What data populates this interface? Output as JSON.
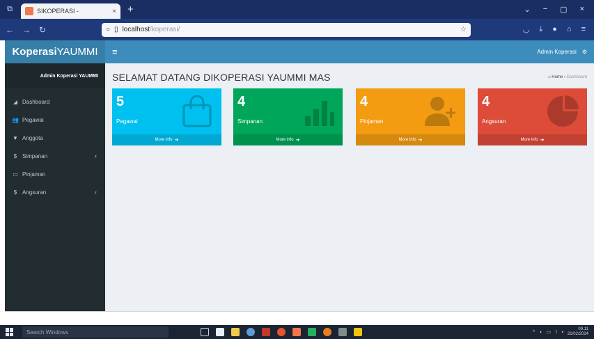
{
  "browser": {
    "tab_title": "SIKOPERASI - ",
    "tab_close": "×",
    "new_tab": "+",
    "url_host": "localhost",
    "url_path": "/koperasi/",
    "window_controls": [
      "⌄",
      "−",
      "▢",
      "×"
    ]
  },
  "app": {
    "brand_bold": "Koperasi",
    "brand_rest": "YAUMMI",
    "menu_toggle": "≡",
    "user_name": "Admin Koperasi",
    "sidebar_user": "Admin Koperasi YAUMMI"
  },
  "sidebar": {
    "items": [
      {
        "label": "Dashboard",
        "icon": "dashboard-icon",
        "glyph": "◢",
        "has_children": false
      },
      {
        "label": "Pegawai",
        "icon": "users-icon",
        "glyph": "👥",
        "has_children": false
      },
      {
        "label": "Anggota",
        "icon": "user-icon",
        "glyph": "▼",
        "has_children": false
      },
      {
        "label": "Simpanan",
        "icon": "dollar-icon",
        "glyph": "$",
        "has_children": true
      },
      {
        "label": "Pinjaman",
        "icon": "money-icon",
        "glyph": "▭",
        "has_children": false
      },
      {
        "label": "Angsuran",
        "icon": "dollar-icon",
        "glyph": "$",
        "has_children": true
      }
    ],
    "chevron": "‹"
  },
  "page": {
    "header": "SELAMAT DATANG DIKOPERASI YAUMMI MAS",
    "breadcrumb_home": "Home",
    "breadcrumb_current": "Dashboard",
    "breadcrumb_sep": "›"
  },
  "boxes": [
    {
      "value": "5",
      "label": "Pegawai",
      "more": "More info",
      "color": "#00c0ef",
      "icon": "shopping-bag-icon"
    },
    {
      "value": "4",
      "label": "Simpanan",
      "more": "More info",
      "color": "#00a65a",
      "icon": "bar-chart-icon"
    },
    {
      "value": "4",
      "label": "Pinjaman",
      "more": "More info",
      "color": "#f39c12",
      "icon": "user-plus-icon"
    },
    {
      "value": "4",
      "label": "Angsuran",
      "more": "More info",
      "color": "#dd4b39",
      "icon": "pie-chart-icon"
    }
  ],
  "taskbar": {
    "search_placeholder": "Search Windows",
    "time": "09.11",
    "date": "21/02/2024"
  }
}
